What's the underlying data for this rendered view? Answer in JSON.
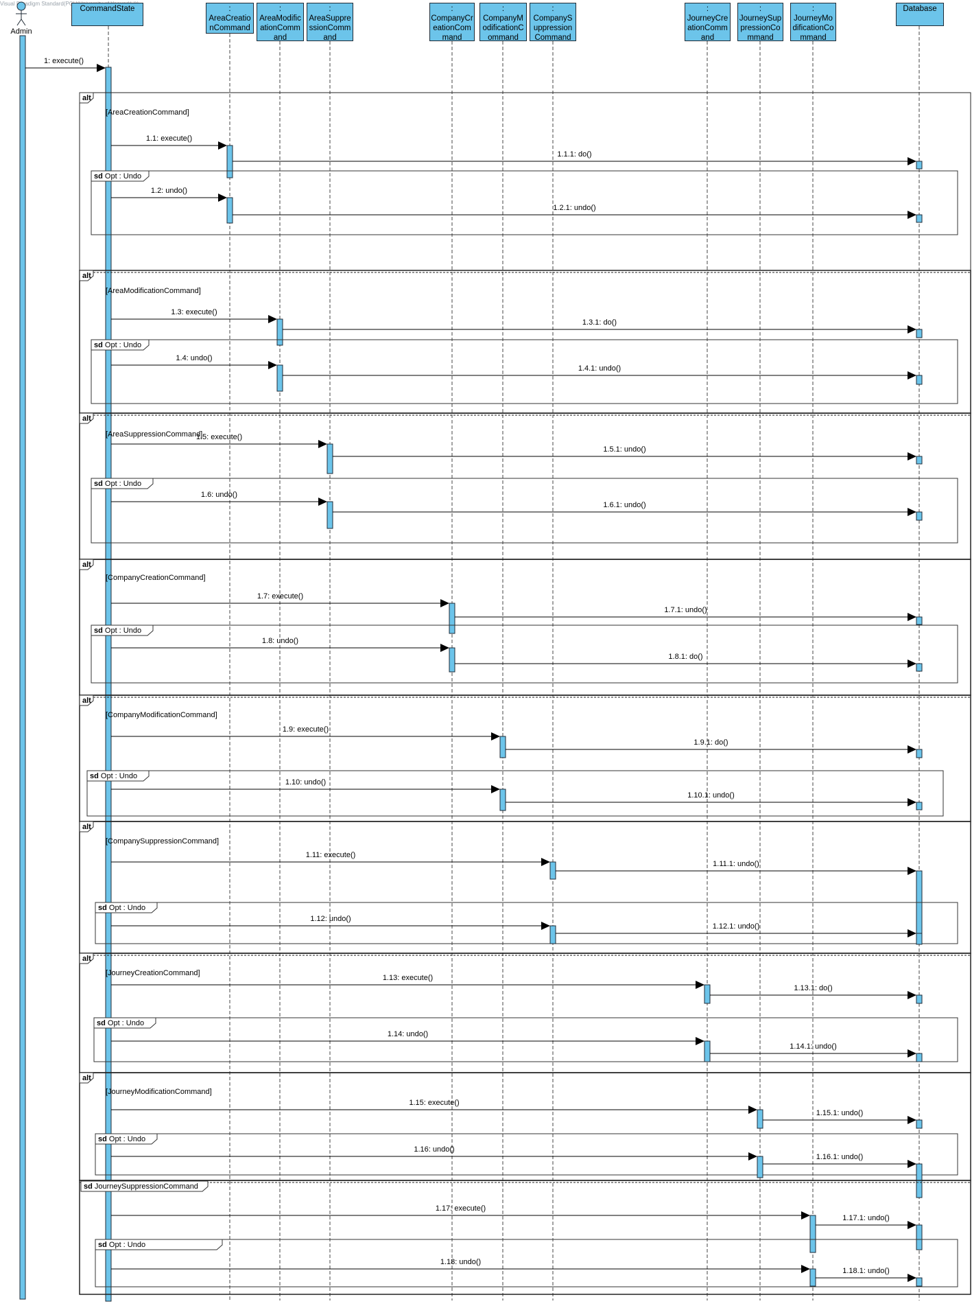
{
  "watermark": "Visual Paradigm Standard(PCH(University of Yaoundé I))",
  "actor": {
    "name": "Admin"
  },
  "lifelines": [
    {
      "id": "cs",
      "lines": [
        "CommandState"
      ]
    },
    {
      "id": "acc",
      "lines": [
        ":",
        "AreaCreatio",
        "nCommand"
      ]
    },
    {
      "id": "amc",
      "lines": [
        ":",
        "AreaModific",
        "ationComm",
        "and"
      ]
    },
    {
      "id": "asc",
      "lines": [
        ":",
        "AreaSuppre",
        "ssionComm",
        "and"
      ]
    },
    {
      "id": "ccc",
      "lines": [
        ":",
        "CompanyCr",
        "eationCom",
        "mand"
      ]
    },
    {
      "id": "cmc",
      "lines": [
        ":",
        "CompanyM",
        "odificationC",
        "ommand"
      ]
    },
    {
      "id": "csc",
      "lines": [
        ":",
        "CompanyS",
        "uppression",
        "Command"
      ]
    },
    {
      "id": "jcc",
      "lines": [
        ":",
        "JourneyCre",
        "ationComm",
        "and"
      ]
    },
    {
      "id": "jsc",
      "lines": [
        ":",
        "JourneySup",
        "pressionCo",
        "mmand"
      ]
    },
    {
      "id": "jmc",
      "lines": [
        ":",
        "JourneyMo",
        "dificationCo",
        "mmand"
      ]
    },
    {
      "id": "db",
      "lines": [
        "Database"
      ]
    }
  ],
  "first_message": "1: execute()",
  "frame_keywords": {
    "alt": "alt",
    "sd": "sd"
  },
  "fragments": [
    {
      "kind": "alt",
      "guard": "[AreaCreationCommand]",
      "target": "acc",
      "msgs": [
        "1.1: execute()",
        "1.1.1: do()"
      ],
      "opt": {
        "title": "Opt : Undo",
        "msgs": [
          "1.2: undo()",
          "1.2.1: undo()"
        ]
      }
    },
    {
      "kind": "alt",
      "guard": "[AreaModificationCommand]",
      "target": "amc",
      "msgs": [
        "1.3: execute()",
        "1.3.1: do()"
      ],
      "opt": {
        "title": "Opt : Undo",
        "msgs": [
          "1.4: undo()",
          "1.4.1: undo()"
        ]
      }
    },
    {
      "kind": "alt",
      "guard": "[AreaSuppressionCommand]",
      "target": "asc",
      "msgs": [
        "1.5: execute()",
        "1.5.1: undo()"
      ],
      "opt": {
        "title": "Opt : Undo",
        "msgs": [
          "1.6: undo()",
          "1.6.1: undo()"
        ]
      }
    },
    {
      "kind": "alt",
      "guard": "[CompanyCreationCommand]",
      "target": "ccc",
      "msgs": [
        "1.7: execute()",
        "1.7.1: undo()"
      ],
      "opt": {
        "title": "Opt : Undo",
        "msgs": [
          "1.8: undo()",
          "1.8.1: do()"
        ]
      }
    },
    {
      "kind": "alt",
      "guard": "[CompanyModificationCommand]",
      "target": "cmc",
      "msgs": [
        "1.9: execute()",
        "1.9.1: do()"
      ],
      "opt": {
        "title": "Opt : Undo",
        "msgs": [
          "1.10: undo()",
          "1.10.1: undo()"
        ]
      }
    },
    {
      "kind": "alt",
      "guard": "[CompanySuppressionCommand]",
      "target": "csc",
      "msgs": [
        "1.11: execute()",
        "1.11.1: undo()"
      ],
      "opt": {
        "title": "Opt : Undo",
        "msgs": [
          "1.12: undo()",
          "1.12.1: undo()"
        ]
      }
    },
    {
      "kind": "alt",
      "guard": "[JourneyCreationCommand]",
      "target": "jcc",
      "msgs": [
        "1.13: execute()",
        "1.13.1: do()"
      ],
      "opt": {
        "title": "Opt : Undo",
        "msgs": [
          "1.14: undo()",
          "1.14.1: undo()"
        ]
      }
    },
    {
      "kind": "alt",
      "guard": "[JourneyModificationCommand]",
      "target": "jsc",
      "msgs": [
        "1.15: execute()",
        "1.15.1: undo()"
      ],
      "opt": {
        "title": "Opt : Undo",
        "msgs": [
          "1.16: undo()",
          "1.16.1: undo()"
        ]
      }
    },
    {
      "kind": "sd",
      "guard": "JourneySuppressionCommand",
      "target": "jmc",
      "msgs": [
        "1.17: execute()",
        "1.17.1: undo()"
      ],
      "opt": {
        "title": "Opt : Undo",
        "msgs": [
          "1.18: undo()",
          "1.18.1: undo()"
        ]
      }
    }
  ]
}
